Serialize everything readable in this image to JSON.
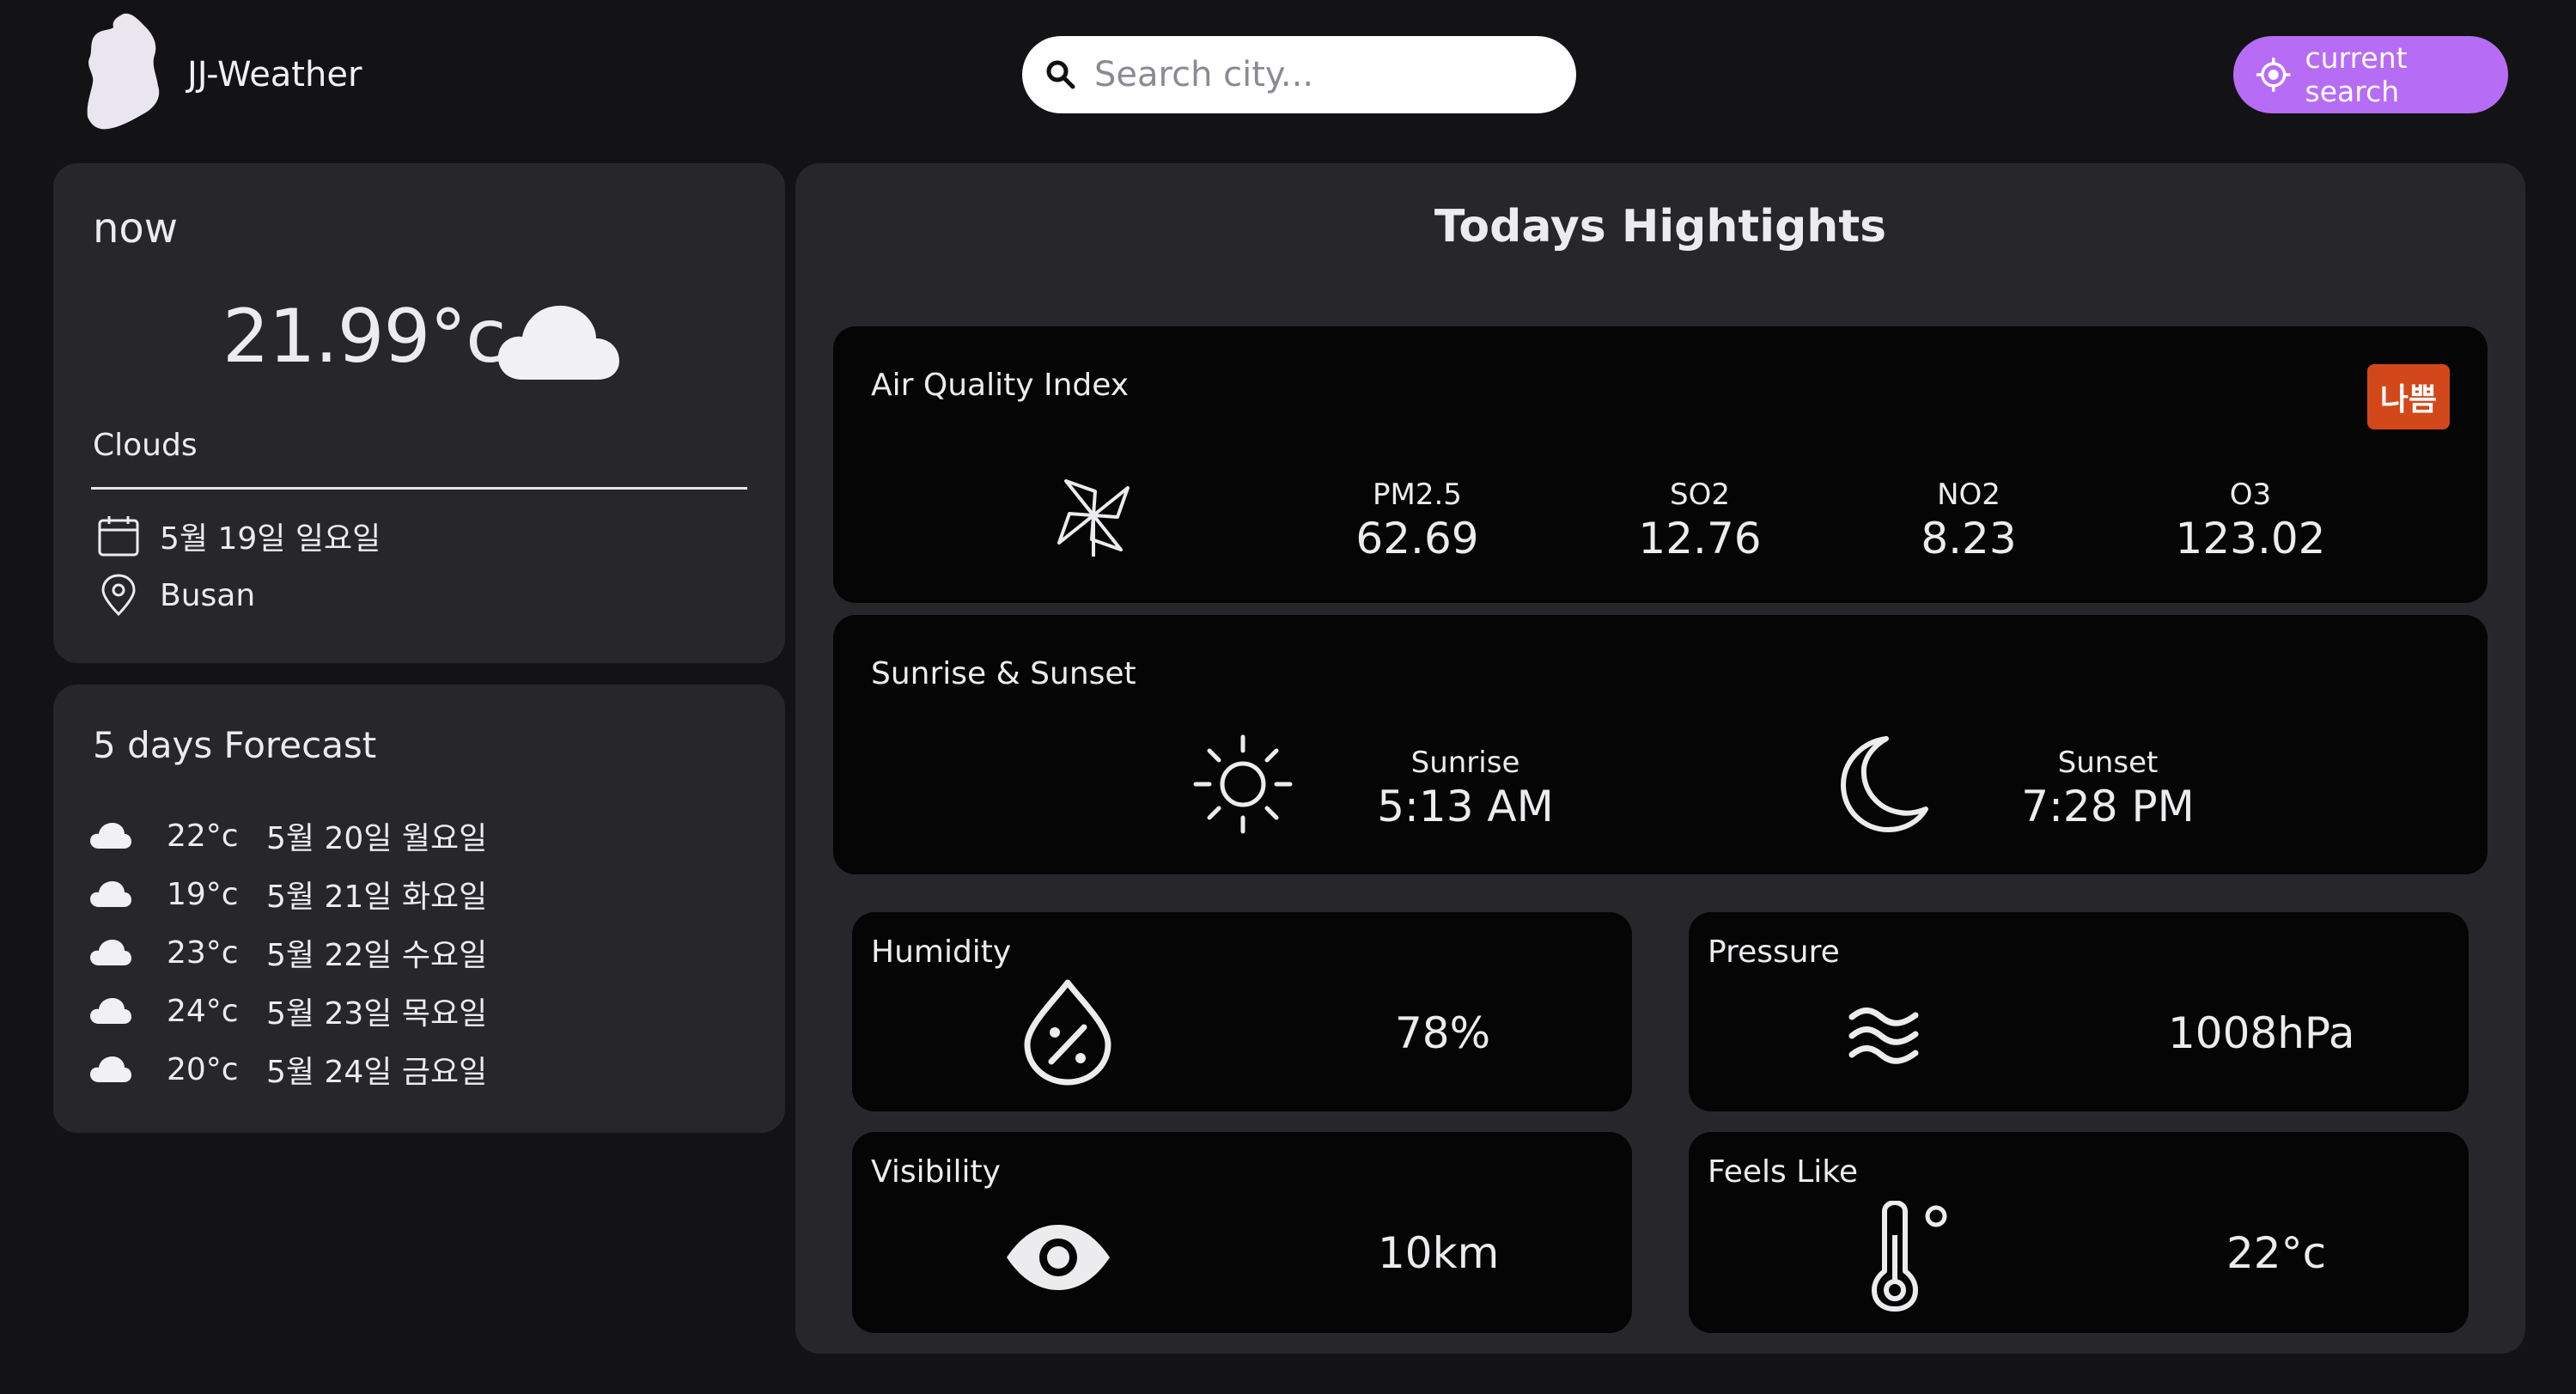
{
  "header": {
    "app_title": "JJ-Weather",
    "search_placeholder": "Search city...",
    "current_location_label": "current search"
  },
  "now": {
    "label": "now",
    "temperature": "21.99°c",
    "description": "Clouds",
    "date": "5월 19일 일요일",
    "location": "Busan",
    "icon": "cloud-icon"
  },
  "forecast": {
    "title": "5 days Forecast",
    "items": [
      {
        "temp": "22°c",
        "date": "5월 20일 월요일",
        "icon": "cloud-icon"
      },
      {
        "temp": "19°c",
        "date": "5월 21일 화요일",
        "icon": "cloud-icon"
      },
      {
        "temp": "23°c",
        "date": "5월 22일 수요일",
        "icon": "cloud-icon"
      },
      {
        "temp": "24°c",
        "date": "5월 23일 목요일",
        "icon": "cloud-icon"
      },
      {
        "temp": "20°c",
        "date": "5월 24일 금요일",
        "icon": "cloud-icon"
      }
    ]
  },
  "highlights": {
    "title": "Todays Hightights",
    "air_quality": {
      "title": "Air Quality Index",
      "badge": "나쁨",
      "badge_color": "#d2481a",
      "items": [
        {
          "label": "PM2.5",
          "value": "62.69"
        },
        {
          "label": "SO2",
          "value": "12.76"
        },
        {
          "label": "NO2",
          "value": "8.23"
        },
        {
          "label": "O3",
          "value": "123.02"
        }
      ]
    },
    "sun": {
      "title": "Sunrise & Sunset",
      "sunrise_label": "Sunrise",
      "sunrise_value": "5:13 AM",
      "sunset_label": "Sunset",
      "sunset_value": "7:28 PM"
    },
    "humidity": {
      "title": "Humidity",
      "value": "78%"
    },
    "pressure": {
      "title": "Pressure",
      "value": "1008hPa"
    },
    "visibility": {
      "title": "Visibility",
      "value": "10km"
    },
    "feels_like": {
      "title": "Feels Like",
      "value": "22°c"
    }
  },
  "colors": {
    "background": "#131316",
    "card": "#27272b",
    "panel": "#050506",
    "accent": "#b66cf5"
  }
}
